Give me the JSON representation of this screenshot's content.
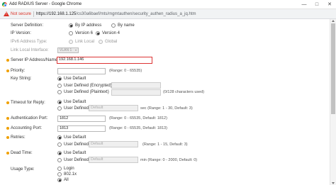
{
  "window": {
    "title": "Add RADIUS Server - Google Chrome",
    "minimize": "—",
    "maximize": "□",
    "close": "✕"
  },
  "addressbar": {
    "security_label": "Not secure",
    "separator": "|",
    "url_host": "https://192.168.1.125",
    "url_path": "/cs30a6baef/mts/mgmtauthen/security_authen_radius_a_jq.htm"
  },
  "form": {
    "server_definition": {
      "label": "Server Definition:",
      "options": [
        "By IP address",
        "By name"
      ],
      "selected": "By IP address"
    },
    "ip_version": {
      "label": "IP Version:",
      "options": [
        "Version 6",
        "Version 4"
      ],
      "selected": "Version 4"
    },
    "ipv6_address_type": {
      "label": "IPv6 Address Type:",
      "options": [
        "Link Local",
        "Global"
      ],
      "selected": "Link Local"
    },
    "link_local_interface": {
      "label": "Link Local Interface:",
      "value": "VLAN 1"
    },
    "server_ip": {
      "label": "Server IP Address/Name:",
      "value": "192.168.1.146"
    },
    "priority": {
      "label": "Priority:",
      "value": "",
      "hint": "(Range: 0 - 65535)"
    },
    "key_string": {
      "label": "Key String:",
      "options": [
        "Use Default",
        "User Defined (Encrypted)",
        "User Defined (Plaintext)"
      ],
      "selected": "Use Default",
      "hint": "(0/128 characters used)"
    },
    "timeout": {
      "label": "Timeout for Reply:",
      "options": [
        "Use Default",
        "User Defined"
      ],
      "selected": "Use Default",
      "placeholder": "Default",
      "hint": "sec (Range: 1 - 30, Default: 3)"
    },
    "auth_port": {
      "label": "Authentication Port:",
      "value": "1812",
      "hint": "(Range: 0 - 65535, Default: 1812)"
    },
    "acct_port": {
      "label": "Accounting Port:",
      "value": "1813",
      "hint": "(Range: 0 - 65535, Default: 1813)"
    },
    "retries": {
      "label": "Retries:",
      "options": [
        "Use Default",
        "User Defined"
      ],
      "selected": "Use Default",
      "placeholder": "Default",
      "hint": "(Range: 1 - 15, Default: 3)"
    },
    "dead_time": {
      "label": "Dead Time:",
      "options": [
        "Use Default",
        "User Defined"
      ],
      "selected": "Use Default",
      "placeholder": "Default",
      "hint": "min (Range: 0 - 2000, Default: 0)"
    },
    "usage_type": {
      "label": "Usage Type:",
      "options": [
        "Login",
        "802.1x",
        "All"
      ],
      "selected": "All"
    }
  },
  "colors": {
    "required_bullet": "#f0a000",
    "highlight_border": "#dd3333",
    "not_secure": "#d93025"
  }
}
